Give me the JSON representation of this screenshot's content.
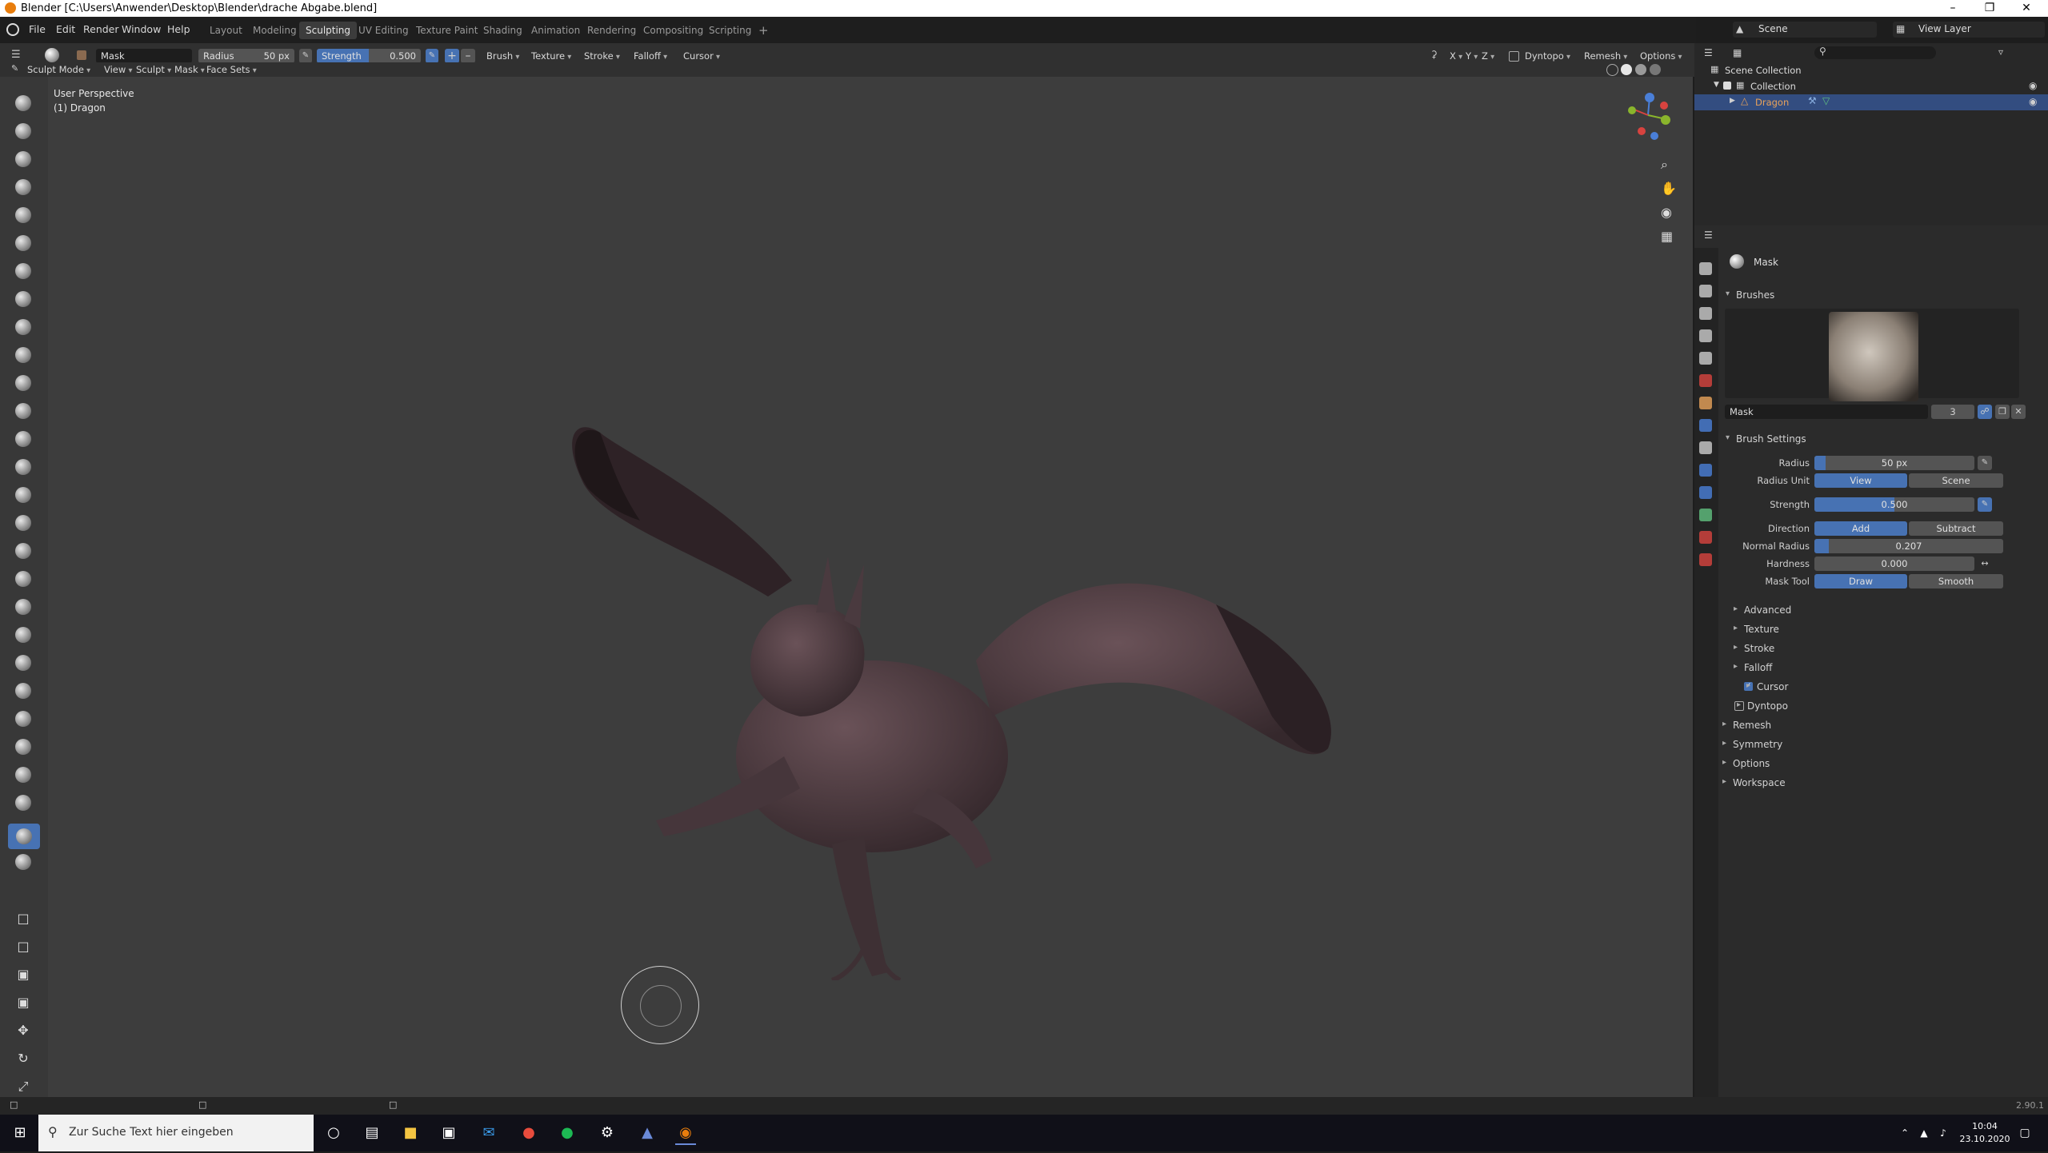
{
  "window": {
    "title": "Blender [C:\\Users\\Anwender\\Desktop\\Blender\\drache Abgabe.blend]"
  },
  "menu": [
    "File",
    "Edit",
    "Render",
    "Window",
    "Help"
  ],
  "workspaces": [
    "Layout",
    "Modeling",
    "Sculpting",
    "UV Editing",
    "Texture Paint",
    "Shading",
    "Animation",
    "Rendering",
    "Compositing",
    "Scripting",
    "+"
  ],
  "active_workspace": "Sculpting",
  "scene": {
    "name": "Scene",
    "view_layer": "View Layer"
  },
  "tool_header": {
    "brush_name": "Mask",
    "radius_label": "Radius",
    "radius_value": "50 px",
    "strength_label": "Strength",
    "strength_value": "0.500",
    "dropdowns": [
      "Brush",
      "Texture",
      "Stroke",
      "Falloff",
      "Cursor"
    ],
    "axes": [
      "X",
      "Y",
      "Z"
    ],
    "right_dropdowns": [
      "Dyntopo",
      "Remesh",
      "Options"
    ]
  },
  "mode_header": {
    "mode": "Sculpt Mode",
    "items": [
      "View",
      "Sculpt",
      "Mask",
      "Face Sets"
    ]
  },
  "viewport": {
    "perspective": "User Perspective",
    "object": "(1) Dragon"
  },
  "outliner": {
    "root": "Scene Collection",
    "collection": "Collection",
    "object": "Dragon"
  },
  "properties": {
    "brush_name": "Mask",
    "brushes_header": "Brushes",
    "brush_slot_name": "Mask",
    "brush_users": "3",
    "brush_settings_header": "Brush Settings",
    "radius_label": "Radius",
    "radius_value": "50 px",
    "radius_unit_label": "Radius Unit",
    "radius_unit_options": [
      "View",
      "Scene"
    ],
    "strength_label": "Strength",
    "strength_value": "0.500",
    "direction_label": "Direction",
    "direction_options": [
      "Add",
      "Subtract"
    ],
    "normal_radius_label": "Normal Radius",
    "normal_radius_value": "0.207",
    "hardness_label": "Hardness",
    "hardness_value": "0.000",
    "mask_tool_label": "Mask Tool",
    "mask_tool_options": [
      "Draw",
      "Smooth"
    ],
    "subsections": [
      "Advanced",
      "Texture",
      "Stroke",
      "Falloff",
      "Cursor"
    ],
    "sections": [
      "Dyntopo",
      "Remesh",
      "Symmetry",
      "Options",
      "Workspace"
    ]
  },
  "status": {
    "version": "2.90.1"
  },
  "taskbar": {
    "search_placeholder": "Zur Suche Text hier eingeben",
    "time": "10:04",
    "date": "23.10.2020"
  },
  "colors": {
    "accent": "#4772b3",
    "viewport_bg": "#3d3d3d",
    "mesh": "#4f3c41"
  }
}
